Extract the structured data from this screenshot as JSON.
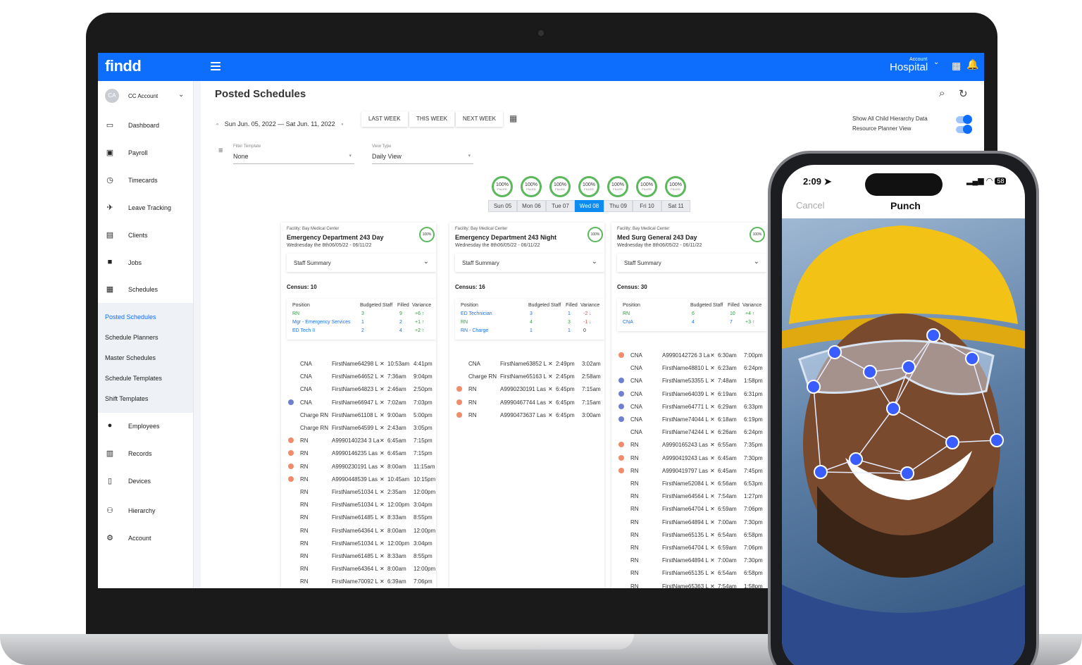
{
  "app": {
    "logo": "findd",
    "account_small": "Account",
    "account_big": "Hospital",
    "page_title": "Posted Schedules"
  },
  "sidebar": {
    "account_initials": "CA",
    "account_name": "CC Account",
    "items": [
      {
        "label": "Dashboard",
        "icon": "laptop-icon"
      },
      {
        "label": "Payroll",
        "icon": "cash-icon"
      },
      {
        "label": "Timecards",
        "icon": "stopwatch-icon"
      },
      {
        "label": "Leave Tracking",
        "icon": "plane-icon"
      },
      {
        "label": "Clients",
        "icon": "contact-icon"
      },
      {
        "label": "Jobs",
        "icon": "briefcase-icon"
      },
      {
        "label": "Schedules",
        "icon": "calendar-icon"
      }
    ],
    "sub_items": [
      "Posted Schedules",
      "Schedule Planners",
      "Master Schedules",
      "Schedule Templates",
      "Shift Templates"
    ],
    "bottom_items": [
      {
        "label": "Employees",
        "icon": "person-icon"
      },
      {
        "label": "Records",
        "icon": "records-icon"
      },
      {
        "label": "Devices",
        "icon": "device-icon"
      },
      {
        "label": "Hierarchy",
        "icon": "hierarchy-icon"
      },
      {
        "label": "Account",
        "icon": "gear-icon"
      }
    ]
  },
  "toolbar": {
    "date_range": "Sun Jun. 05, 2022 — Sat Jun. 11, 2022",
    "last_week": "LAST WEEK",
    "this_week": "THIS WEEK",
    "next_week": "NEXT WEEK",
    "toggle_child": "Show All Child Hierarchy Data",
    "toggle_planner": "Resource Planner View",
    "filter_label": "Filter Template",
    "filter_value": "None",
    "view_label": "View Type",
    "view_value": "Daily View"
  },
  "days": {
    "ring_pct": "100%",
    "ring_sub": "FILLED",
    "tabs": [
      "Sun 05",
      "Mon 06",
      "Tue 07",
      "Wed 08",
      "Thu 09",
      "Fri 10",
      "Sat 11"
    ],
    "active_index": 3
  },
  "summary_headers": [
    "Position",
    "Budgeted Staff",
    "Filled",
    "Variance"
  ],
  "cards": [
    {
      "facility": "Facility: Bay Medical Center",
      "title": "Emergency Department 243 Day",
      "date": "Wednesday the 8th06/05/22 - 06/11/22",
      "ring": "100%",
      "staff_summary": "Staff Summary",
      "census": "Census: 10",
      "summary": [
        {
          "pos": "RN",
          "budget": "3",
          "filled": "9",
          "var": "+6 ↑",
          "pcolor": "green",
          "vcolor": "green"
        },
        {
          "pos": "Mgr - Emergency Services",
          "budget": "1",
          "filled": "2",
          "var": "+1 ↑",
          "pcolor": "blue",
          "vcolor": "green"
        },
        {
          "pos": "ED Tech II",
          "budget": "2",
          "filled": "4",
          "var": "+2 ↑",
          "pcolor": "blue",
          "vcolor": "green"
        }
      ],
      "shifts": [
        {
          "role": "CNA",
          "name": "FirstName64298 L",
          "start": "10:53am",
          "end": "4:41pm",
          "dot": ""
        },
        {
          "role": "CNA",
          "name": "FirstName64652 L",
          "start": "7:36am",
          "end": "9:04pm",
          "dot": ""
        },
        {
          "role": "CNA",
          "name": "FirstName64823 L",
          "start": "2:46am",
          "end": "2:50pm",
          "dot": ""
        },
        {
          "role": "CNA",
          "name": "FirstName66947 L",
          "start": "7:02am",
          "end": "7:03pm",
          "dot": "blue"
        },
        {
          "role": "Charge RN",
          "name": "FirstName61108 L",
          "start": "9:00am",
          "end": "5:00pm",
          "dot": ""
        },
        {
          "role": "Charge RN",
          "name": "FirstName64599 L",
          "start": "2:43am",
          "end": "3:05pm",
          "dot": ""
        },
        {
          "role": "RN",
          "name": "A9990140234 3 La",
          "start": "6:45am",
          "end": "7:15pm",
          "dot": "orange"
        },
        {
          "role": "RN",
          "name": "A9990146235 Las",
          "start": "6:45am",
          "end": "7:15pm",
          "dot": "orange"
        },
        {
          "role": "RN",
          "name": "A9990230191 Las",
          "start": "8:00am",
          "end": "11:15am",
          "dot": "orange"
        },
        {
          "role": "RN",
          "name": "A9990448539 Las",
          "start": "10:45am",
          "end": "10:15pm",
          "dot": "orange"
        },
        {
          "role": "RN",
          "name": "FirstName51034 L",
          "start": "2:35am",
          "end": "12:00pm",
          "dot": ""
        },
        {
          "role": "RN",
          "name": "FirstName51034 L",
          "start": "12:00pm",
          "end": "3:04pm",
          "dot": ""
        },
        {
          "role": "RN",
          "name": "FirstName61485 L",
          "start": "8:33am",
          "end": "8:55pm",
          "dot": ""
        },
        {
          "role": "RN",
          "name": "FirstName64364 L",
          "start": "8:00am",
          "end": "12:00pm",
          "dot": ""
        },
        {
          "role": "RN",
          "name": "FirstName51034 L",
          "start": "12:00pm",
          "end": "3:04pm",
          "dot": ""
        },
        {
          "role": "RN",
          "name": "FirstName61485 L",
          "start": "8:33am",
          "end": "8:55pm",
          "dot": ""
        },
        {
          "role": "RN",
          "name": "FirstName64364 L",
          "start": "8:00am",
          "end": "12:00pm",
          "dot": ""
        },
        {
          "role": "RN",
          "name": "FirstName70092 L",
          "start": "6:39am",
          "end": "7:06pm",
          "dot": ""
        }
      ]
    },
    {
      "facility": "Facility: Bay Medical Center",
      "title": "Emergency Department 243 Night",
      "date": "Wednesday the 8th06/05/22 - 06/11/22",
      "ring": "100%",
      "staff_summary": "Staff Summary",
      "census": "Census: 16",
      "summary": [
        {
          "pos": "ED Technician",
          "budget": "3",
          "filled": "1",
          "var": "-2 ↓",
          "pcolor": "blue",
          "vcolor": "red"
        },
        {
          "pos": "RN",
          "budget": "4",
          "filled": "3",
          "var": "-1 ↓",
          "pcolor": "green",
          "vcolor": "red"
        },
        {
          "pos": "RN - Charge",
          "budget": "1",
          "filled": "1",
          "var": "0",
          "pcolor": "blue",
          "vcolor": "dark"
        }
      ],
      "shifts": [
        {
          "role": "CNA",
          "name": "FirstName63852 L",
          "start": "2:49pm",
          "end": "3:02am",
          "dot": ""
        },
        {
          "role": "Charge RN",
          "name": "FirstName65163 L",
          "start": "2:45pm",
          "end": "2:58am",
          "dot": ""
        },
        {
          "role": "RN",
          "name": "A9990230191 Las",
          "start": "6:45pm",
          "end": "7:15am",
          "dot": "orange"
        },
        {
          "role": "RN",
          "name": "A9990467744 Las",
          "start": "6:45pm",
          "end": "7:15am",
          "dot": "orange"
        },
        {
          "role": "RN",
          "name": "A9990473637 Las",
          "start": "6:45pm",
          "end": "3:00am",
          "dot": "orange"
        }
      ]
    },
    {
      "facility": "Facility: Bay Medical Center",
      "title": "Med Surg General 243 Day",
      "date": "Wednesday the 8th06/05/22 - 06/11/22",
      "ring": "100%",
      "staff_summary": "Staff Summary",
      "census": "Census: 30",
      "summary": [
        {
          "pos": "RN",
          "budget": "6",
          "filled": "10",
          "var": "+4 ↑",
          "pcolor": "green",
          "vcolor": "green"
        },
        {
          "pos": "CNA",
          "budget": "4",
          "filled": "7",
          "var": "+3 ↑",
          "pcolor": "blue",
          "vcolor": "green"
        }
      ],
      "shifts": [
        {
          "role": "CNA",
          "name": "A9990142726 3 La",
          "start": "6:30am",
          "end": "7:00pm",
          "dot": "orange"
        },
        {
          "role": "CNA",
          "name": "FirstName48810 L",
          "start": "6:23am",
          "end": "6:24pm",
          "dot": ""
        },
        {
          "role": "CNA",
          "name": "FirstName53355 L",
          "start": "7:48am",
          "end": "1:58pm",
          "dot": "blue"
        },
        {
          "role": "CNA",
          "name": "FirstName64039 L",
          "start": "6:19am",
          "end": "6:31pm",
          "dot": "blue"
        },
        {
          "role": "CNA",
          "name": "FirstName64771 L",
          "start": "6:29am",
          "end": "6:33pm",
          "dot": "blue"
        },
        {
          "role": "CNA",
          "name": "FirstName74044 L",
          "start": "6:18am",
          "end": "6:19pm",
          "dot": "blue"
        },
        {
          "role": "CNA",
          "name": "FirstName74244 L",
          "start": "6:26am",
          "end": "6:24pm",
          "dot": ""
        },
        {
          "role": "RN",
          "name": "A9990165243 Las",
          "start": "6:55am",
          "end": "7:35pm",
          "dot": "orange"
        },
        {
          "role": "RN",
          "name": "A9990419243 Las",
          "start": "6:45am",
          "end": "7:30pm",
          "dot": "orange"
        },
        {
          "role": "RN",
          "name": "A9990419797 Las",
          "start": "6:45am",
          "end": "7:45pm",
          "dot": "orange"
        },
        {
          "role": "RN",
          "name": "FirstName52084 L",
          "start": "6:56am",
          "end": "6:53pm",
          "dot": ""
        },
        {
          "role": "RN",
          "name": "FirstName64564 L",
          "start": "7:54am",
          "end": "1:27pm",
          "dot": ""
        },
        {
          "role": "RN",
          "name": "FirstName64704 L",
          "start": "6:59am",
          "end": "7:06pm",
          "dot": ""
        },
        {
          "role": "RN",
          "name": "FirstName64894 L",
          "start": "7:00am",
          "end": "7:30pm",
          "dot": ""
        },
        {
          "role": "RN",
          "name": "FirstName65135 L",
          "start": "6:54am",
          "end": "6:58pm",
          "dot": ""
        },
        {
          "role": "RN",
          "name": "FirstName64704 L",
          "start": "6:59am",
          "end": "7:06pm",
          "dot": ""
        },
        {
          "role": "RN",
          "name": "FirstName64894 L",
          "start": "7:00am",
          "end": "7:30pm",
          "dot": ""
        },
        {
          "role": "RN",
          "name": "FirstName65135 L",
          "start": "6:54am",
          "end": "6:58pm",
          "dot": ""
        },
        {
          "role": "RN",
          "name": "FirstName65363 L",
          "start": "7:54am",
          "end": "1:58pm",
          "dot": ""
        }
      ]
    }
  ],
  "phone": {
    "time": "2:09",
    "battery": "58",
    "cancel": "Cancel",
    "title": "Punch"
  },
  "colors": {
    "brand_blue": "#0d6efd",
    "ring_green": "#5cb85c",
    "active_tab": "#0d8bf0"
  }
}
